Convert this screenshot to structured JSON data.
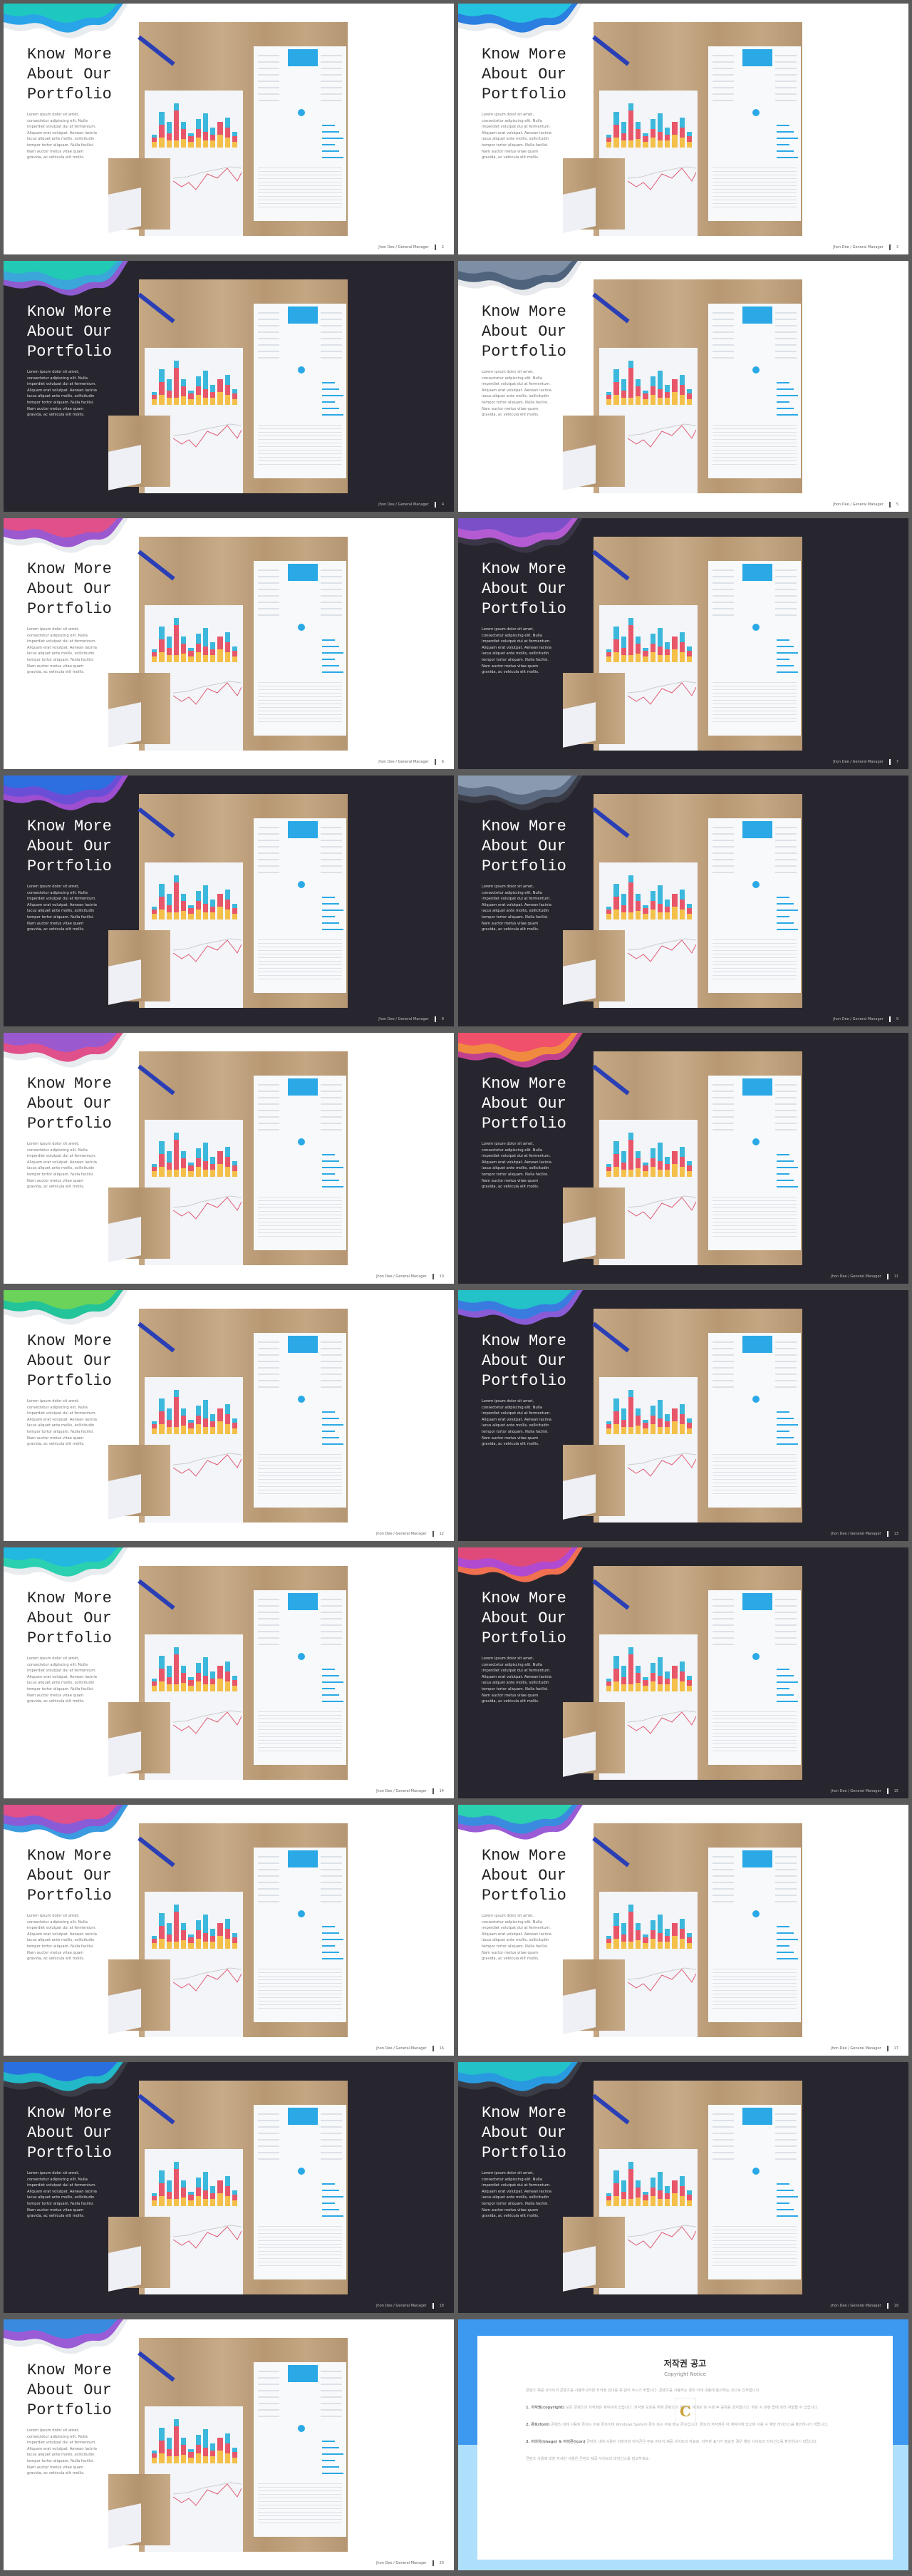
{
  "slide_common": {
    "title": "Know More\nAbout Our\nPortfolio",
    "body": "Lorem ipsum dolor sit amet, consectetur adipiscing elit. Nulla imperdiet volutpat dui at fermentum. Aliquam erat volutpat. Aenean lacinia lacus aliquet ante mollis, sollicitudin tempor tortor aliquam. Nulla facilisi. Nam auctor metus vitae quam gravida, ac vehicula elit mollis.",
    "footer": "Jhon Dee / General Manager"
  },
  "slides": [
    {
      "page": "2",
      "theme": "light",
      "wave": [
        "#1ec8c0",
        "#2aa4e8",
        "#e9ecef"
      ]
    },
    {
      "page": "3",
      "theme": "light",
      "wave": [
        "#25c3e0",
        "#2a7fe0",
        "#e9ecef"
      ]
    },
    {
      "page": "4",
      "theme": "dark",
      "wave": [
        "#22c9b5",
        "#3aa6d9",
        "#8e5bd0"
      ]
    },
    {
      "page": "5",
      "theme": "light",
      "wave": [
        "#7d8ea5",
        "#4f637d",
        "#e6e8eb"
      ]
    },
    {
      "page": "6",
      "theme": "light",
      "wave": [
        "#e0508a",
        "#9b59d0",
        "#e9ecef"
      ]
    },
    {
      "page": "7",
      "theme": "dark",
      "wave": [
        "#7a4fc8",
        "#b45bd3",
        "#3a3648"
      ]
    },
    {
      "page": "8",
      "theme": "dark",
      "wave": [
        "#2d6fe0",
        "#6a4fd6",
        "#9d4fd0"
      ]
    },
    {
      "page": "9",
      "theme": "dark",
      "wave": [
        "#8a9ab0",
        "#5b6a80",
        "#3a3d48"
      ]
    },
    {
      "page": "10",
      "theme": "light",
      "wave": [
        "#9b59d0",
        "#e0508a",
        "#e9ecef"
      ]
    },
    {
      "page": "11",
      "theme": "dark",
      "wave": [
        "#f0506a",
        "#f08a40",
        "#c04090"
      ]
    },
    {
      "page": "12",
      "theme": "light",
      "wave": [
        "#6cd35a",
        "#24c49a",
        "#e9ecef"
      ]
    },
    {
      "page": "13",
      "theme": "dark",
      "wave": [
        "#22c2c8",
        "#3a7be0",
        "#8a5bd6"
      ]
    },
    {
      "page": "14",
      "theme": "light",
      "wave": [
        "#22b8e0",
        "#2ad0b0",
        "#e9ecef"
      ]
    },
    {
      "page": "15",
      "theme": "dark",
      "wave": [
        "#e04a7a",
        "#b04ad0",
        "#f07050"
      ]
    },
    {
      "page": "16",
      "theme": "light",
      "wave": [
        "#e0508a",
        "#8a5bd6",
        "#3a9be0"
      ]
    },
    {
      "page": "17",
      "theme": "light",
      "wave": [
        "#2ad0b0",
        "#3a8be0",
        "#9a5bd6"
      ]
    },
    {
      "page": "18",
      "theme": "dark",
      "wave": [
        "#2a6fe0",
        "#22b8c8",
        "#3a3d48"
      ]
    },
    {
      "page": "19",
      "theme": "dark",
      "wave": [
        "#22c2c8",
        "#2a9ae0",
        "#3a3d48"
      ]
    },
    {
      "page": "20",
      "theme": "light",
      "wave": [
        "#3a8be0",
        "#9a5bd6",
        "#e9ecef"
      ]
    }
  ],
  "copyright": {
    "title": "저작권 공고",
    "subtitle": "Copyright Notice",
    "intro": "콘텐츠 제공 사이트의 콘텐츠를 사용하시려면 저작권 안내를 꼭 읽어 주시기 바랍니다. 콘텐츠를 사용하는 경우 아래 내용에 동의하는 것으로 간주합니다.",
    "sections": [
      {
        "label": "1. 저작권(copyright)",
        "text": "모든 콘텐츠의 저작권은 제작사에 있습니다. 저작권 보호를 위해 콘텐츠의 재판매, 재배포 및 수정 후 공유를 금지합니다. 위반 시 관련 법에 따라 처벌될 수 있습니다."
      },
      {
        "label": "2. 폰트(font)",
        "text": "콘텐츠 내에 사용된 폰트는 무료 폰트이며 Windows System 폰트 또는 무료 배포 폰트입니다. 폰트의 저작권은 각 제작사에 있으며 사용 시 해당 라이선스를 확인하시기 바랍니다."
      },
      {
        "label": "3. 이미지(image) & 아이콘(icon)",
        "text": "콘텐츠 내에 사용된 이미지와 아이콘은 무료 이미지 제공 사이트의 자료로, 저작권 표기가 필요한 경우 해당 사이트의 라이선스를 확인하시기 바랍니다."
      }
    ],
    "outro": "콘텐츠 사용에 대한 자세한 사항은 콘텐츠 제공 사이트의 라이선스를 참고하세요.",
    "logo_letter": "C"
  },
  "colors": {
    "page_bg": "#5b5b5b",
    "dark_bg": "#27262e",
    "copyright_blue": "#3d99f0",
    "copyright_light": "#aee0fb"
  }
}
